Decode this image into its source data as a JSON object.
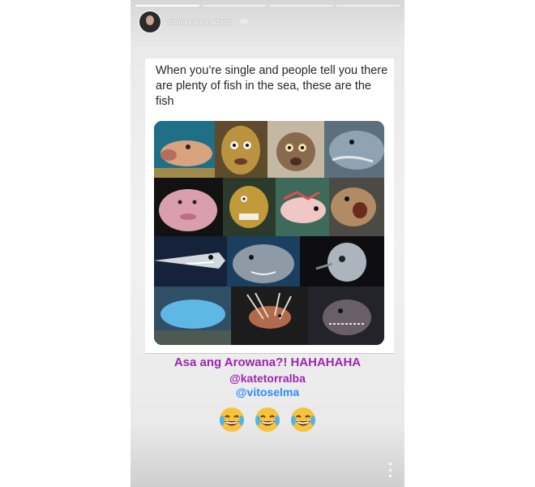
{
  "story": {
    "progress_segments": 4,
    "progress_done": 1,
    "header": {
      "username": "maria.elena.adarna",
      "time": "8h",
      "avatar_icon": "profile-photo"
    },
    "post": {
      "text": "When you’re single and people tell you there are plenty of fish in the sea, these are the fish",
      "image_grid_icon": "fish-collage"
    },
    "caption": {
      "line1": "Asa ang Arowana?! HAHAHAHA",
      "mention1": "@katetorralba",
      "mention2": "@vitoselma",
      "line1_color": "#9c27b0",
      "mention2_color": "#2f8cff"
    },
    "emojis": [
      "face-with-tears-of-joy",
      "face-with-tears-of-joy",
      "face-with-tears-of-joy"
    ],
    "more_icon": "more-vertical-icon"
  }
}
